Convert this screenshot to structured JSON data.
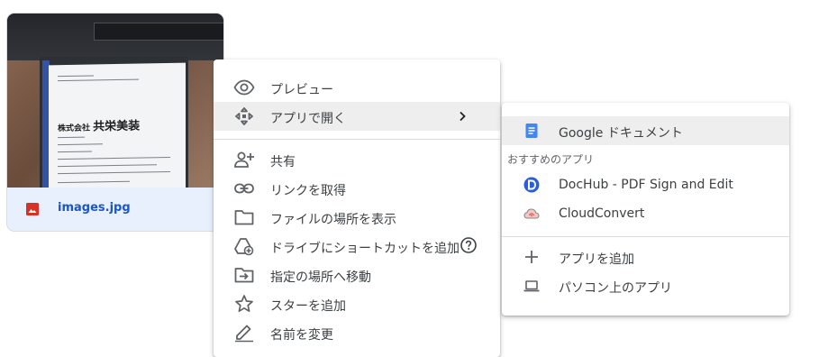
{
  "file": {
    "name": "images.jpg",
    "type_icon": "image-file-icon",
    "icon_color": "#d93025",
    "name_color": "#1a56c7",
    "card_bg": "#e8f0fe",
    "thumbnail": {
      "card_text_company": "株式会社",
      "card_text_company_name": "共栄美装"
    }
  },
  "context_menu": {
    "items": [
      {
        "label": "プレビュー",
        "icon": "eye-icon"
      },
      {
        "label": "アプリで開く",
        "icon": "open-with-icon",
        "has_submenu": true,
        "highlighted": true
      },
      {
        "label": "共有",
        "icon": "person-add-icon"
      },
      {
        "label": "リンクを取得",
        "icon": "link-icon"
      },
      {
        "label": "ファイルの場所を表示",
        "icon": "folder-icon"
      },
      {
        "label": "ドライブにショートカットを追加",
        "icon": "add-shortcut-icon"
      },
      {
        "label": "指定の場所へ移動",
        "icon": "move-to-folder-icon"
      },
      {
        "label": "スターを追加",
        "icon": "star-outline-icon"
      },
      {
        "label": "名前を変更",
        "icon": "pencil-icon"
      }
    ],
    "help_icon": "help-circle-icon"
  },
  "submenu": {
    "items": [
      {
        "label": "Google ドキュメント",
        "icon": "google-docs-icon",
        "icon_color": "#4285f4",
        "highlighted": true
      }
    ],
    "suggested_heading": "おすすめのアプリ",
    "suggested_apps": [
      {
        "label": "DocHub - PDF Sign and Edit",
        "icon": "dochub-icon",
        "icon_color": "#2b5fd9"
      },
      {
        "label": "CloudConvert",
        "icon": "cloudconvert-icon",
        "icon_color": "#e35a5a"
      }
    ],
    "actions": [
      {
        "label": "アプリを追加",
        "icon": "plus-icon"
      },
      {
        "label": "パソコン上のアプリ",
        "icon": "laptop-icon"
      }
    ]
  },
  "colors": {
    "highlight_bg": "#eeeeee",
    "text": "#3c4043",
    "icon": "#5f6368",
    "divider": "#dadce0"
  }
}
